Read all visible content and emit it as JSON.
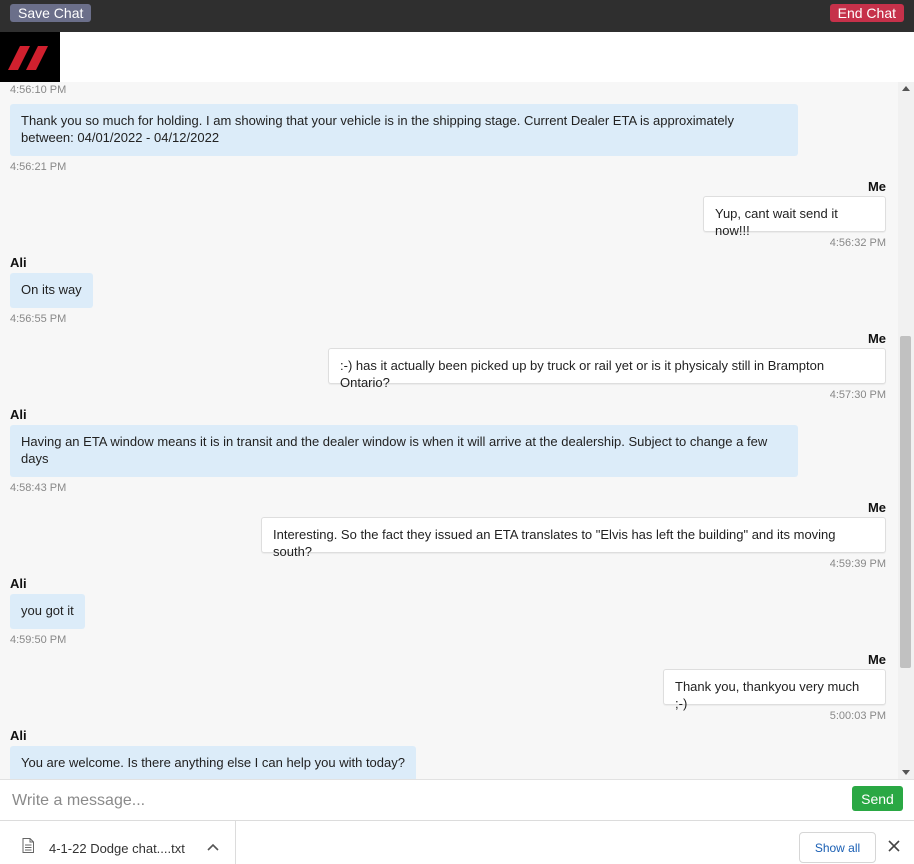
{
  "toolbar": {
    "save_label": "Save Chat",
    "end_label": "End Chat"
  },
  "colors": {
    "agent_bubble": "#dcecf9",
    "me_bubble": "#ffffff",
    "send": "#2aa844",
    "end": "#c6314a",
    "save": "#6b6f8a"
  },
  "chat": {
    "first_time": "4:56:10 PM",
    "messages": [
      {
        "sender": "",
        "text": "Thank you so much for holding. I am showing that your vehicle is in the shipping stage. Current Dealer ETA is approximately between: 04/01/2022 - 04/12/2022",
        "time": "4:56:21 PM"
      },
      {
        "sender": "Me",
        "text": "Yup, cant wait send it now!!!",
        "time": "4:56:32 PM"
      },
      {
        "sender": "Ali",
        "text": "On its way",
        "time": "4:56:55 PM"
      },
      {
        "sender": "Me",
        "text": ":-) has it actually been picked up by truck or rail yet or is it physicaly still in Brampton Ontario?",
        "time": "4:57:30 PM"
      },
      {
        "sender": "Ali",
        "text": "Having an ETA window means it is in transit and the dealer window is when it will arrive at the dealership. Subject to change a few days",
        "time": "4:58:43 PM"
      },
      {
        "sender": "Me",
        "text": "Interesting. So the fact they issued an ETA translates to \"Elvis has left the building\" and its moving south?",
        "time": "4:59:39 PM"
      },
      {
        "sender": "Ali",
        "text": "you got it",
        "time": "4:59:50 PM"
      },
      {
        "sender": "Me",
        "text": "Thank you, thankyou very much ;-)",
        "time": "5:00:03 PM"
      },
      {
        "sender": "Ali",
        "text": "You are welcome. Is there anything else I can help you with today?",
        "time": ""
      }
    ]
  },
  "composer": {
    "placeholder": "Write a message...",
    "send_label": "Send"
  },
  "downloads": {
    "file_name": "4-1-22 Dodge chat....txt",
    "show_all_label": "Show all"
  }
}
